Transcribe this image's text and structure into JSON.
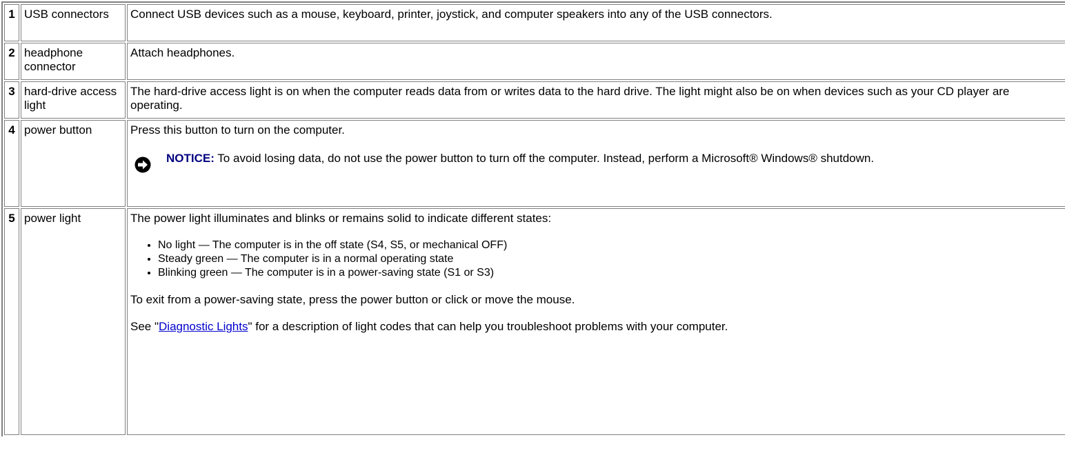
{
  "rows": [
    {
      "num": "1",
      "name": "USB connectors",
      "desc": "Connect USB devices such as a mouse, keyboard, printer, joystick, and computer speakers into any of the USB connectors."
    },
    {
      "num": "2",
      "name": "headphone connector",
      "desc": "Attach headphones."
    },
    {
      "num": "3",
      "name": "hard-drive access light",
      "desc": "The hard-drive access light is on when the computer reads data from or writes data to the hard drive. The light might also be on when devices such as your CD player are operating."
    },
    {
      "num": "4",
      "name": "power button",
      "desc": "Press this button to turn on the computer.",
      "notice_label": "NOTICE:",
      "notice_text": " To avoid losing data, do not use the power button to turn off the computer. Instead, perform a Microsoft® Windows® shutdown.",
      "notice_icon": "notice-arrow-icon"
    },
    {
      "num": "5",
      "name": "power light",
      "desc": "The power light illuminates and blinks or remains solid to indicate different states:",
      "bullets": [
        "No light — The computer is in the off state (S4, S5, or mechanical OFF)",
        "Steady green — The computer is in a normal operating state",
        "Blinking green — The computer is in a power-saving state (S1 or S3)"
      ],
      "exit_text": "To exit from a power-saving state, press the power button or click or move the mouse.",
      "see_prefix": "See \"",
      "see_link": "Diagnostic Lights",
      "see_suffix": "\" for a description of light codes that can help you troubleshoot problems with your computer."
    }
  ],
  "colors": {
    "border": "#808080",
    "notice_label": "#000080",
    "link": "#0000cc"
  }
}
